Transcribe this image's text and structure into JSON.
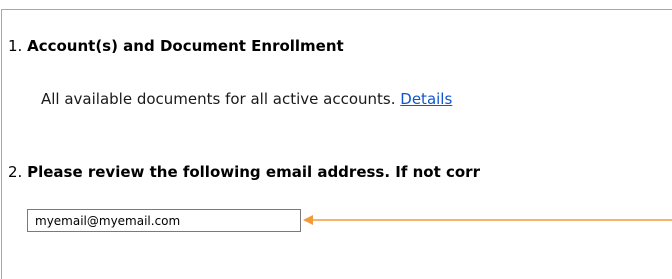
{
  "steps": [
    {
      "number": "1.",
      "title": "Account(s) and Document Enrollment",
      "description": "All available documents for all active accounts.",
      "link": "Details"
    },
    {
      "number": "2.",
      "title": "Please review the following email address. If not corr"
    }
  ],
  "email_field": {
    "value": "myemail@myemail.com"
  },
  "colors": {
    "link": "#1155cc",
    "annotation_arrow": "#f39a3b",
    "panel_border": "#a7a7a7"
  }
}
